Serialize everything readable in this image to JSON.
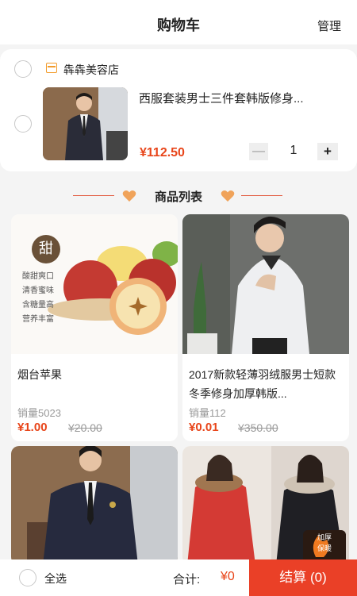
{
  "header": {
    "title": "购物车",
    "manage_label": "管理"
  },
  "cart": {
    "shop_name": "犇犇美容店",
    "items": [
      {
        "title": "西服套装男士三件套韩版修身...",
        "price": "¥112.50",
        "quantity": "1"
      }
    ]
  },
  "stepper": {
    "minus": "—",
    "plus": "+"
  },
  "product_list": {
    "heading": "商品列表",
    "products": [
      {
        "name": "烟台苹果",
        "sales": "销量5023",
        "price": "¥1.00",
        "original_price": "¥20.00",
        "badge": "甜",
        "promo_lines": [
          "酸甜爽口",
          "清香蜜味",
          "含糖量高",
          "营养丰富"
        ]
      },
      {
        "name": "2017新款轻薄羽绒服男士短款冬季修身加厚韩版...",
        "sales": "销量112",
        "price": "¥0.01",
        "original_price": "¥350.00"
      },
      {
        "name": "",
        "sales": "",
        "price": "",
        "original_price": ""
      },
      {
        "name": "",
        "sales": "",
        "price": "",
        "original_price": "",
        "sticker": "加厚保暖"
      }
    ]
  },
  "footer": {
    "select_all_label": "全选",
    "total_label": "合计:",
    "total_value": "¥0",
    "checkout_label": "结算 (0)"
  },
  "colors": {
    "accent": "#ea4027",
    "price": "#e8451a",
    "shop_icon": "#f29b2a"
  }
}
